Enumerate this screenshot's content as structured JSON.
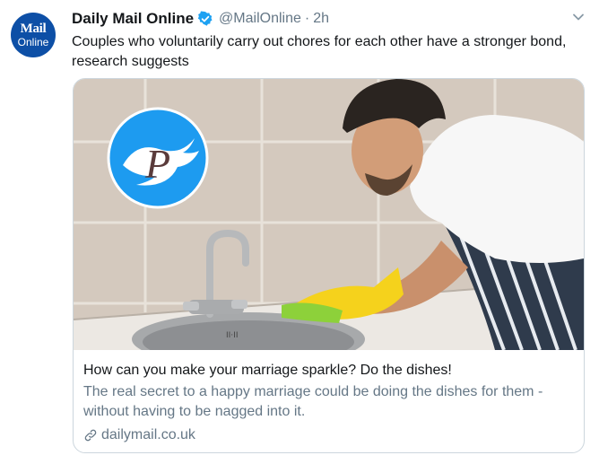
{
  "tweet": {
    "avatar": {
      "line1": "Mail",
      "line2": "Online",
      "bg_color": "#0d4fa6"
    },
    "author_name": "Daily Mail Online",
    "verified_icon": "verified-badge",
    "handle": "@MailOnline",
    "separator": "·",
    "time": "2h",
    "more_icon": "chevron-down-icon",
    "text": "Couples who voluntarily carry out chores for each other have a stronger bond, research suggests"
  },
  "card": {
    "image_description_icon": "photo",
    "overlay_icon": "twitter-bird-logo-with-P",
    "sink_label": "II·II",
    "title": "How can you make your marriage sparkle? Do the dishes!",
    "description": "The real secret to a happy marriage could be doing the dishes for them - without having to be nagged into it.",
    "link_icon": "link-icon",
    "domain": "dailymail.co.uk"
  },
  "colors": {
    "accent": "#1da1f2",
    "text": "#14171a",
    "muted": "#657786",
    "border": "#ccd6dd"
  }
}
